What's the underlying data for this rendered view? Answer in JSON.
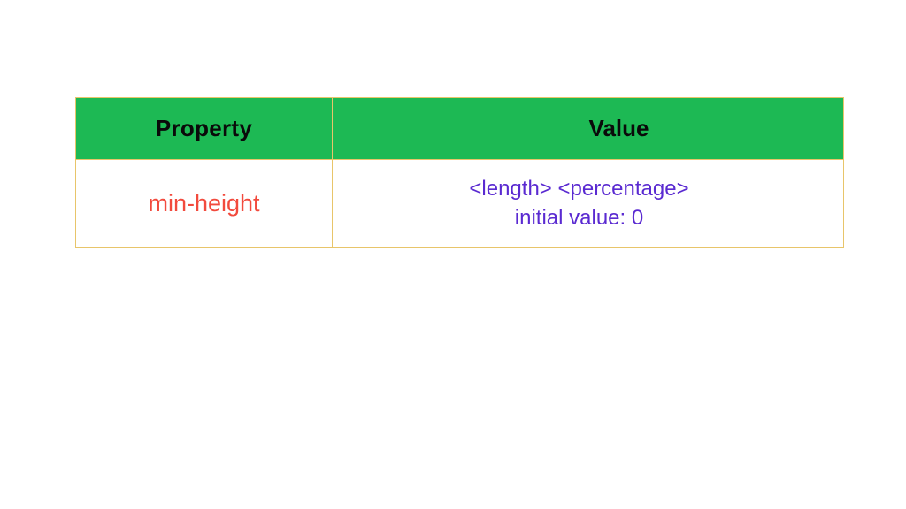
{
  "table": {
    "headers": {
      "property": "Property",
      "value": "Value"
    },
    "row": {
      "property": "min-height",
      "value_line1": "<length> <percentage>",
      "value_line2": "initial value: 0"
    }
  }
}
